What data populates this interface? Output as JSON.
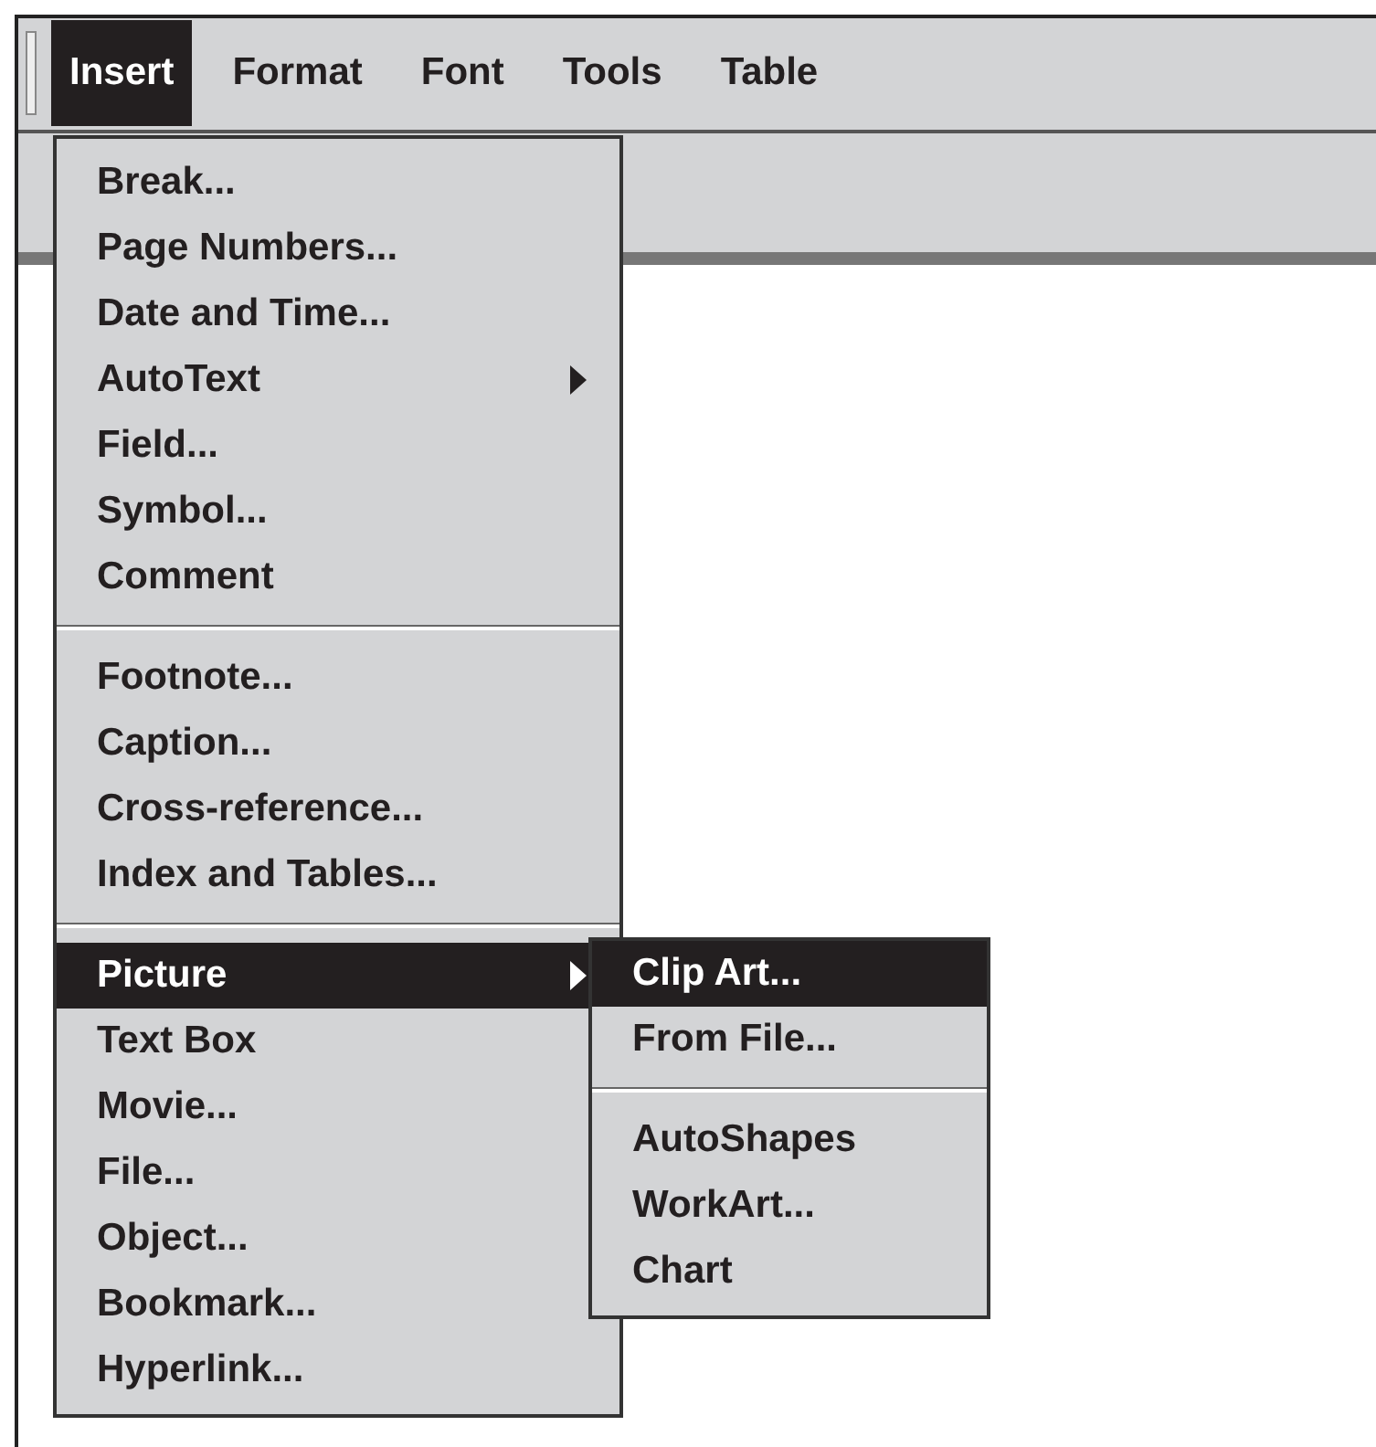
{
  "menu_bar": [
    {
      "label": "Insert",
      "selected": true
    },
    {
      "label": "Format",
      "selected": false
    },
    {
      "label": "Font",
      "selected": false
    },
    {
      "label": "Tools",
      "selected": false
    },
    {
      "label": "Table",
      "selected": false
    }
  ],
  "insert_menu": [
    {
      "kind": "item",
      "label": "Break...",
      "selected": false,
      "submenu": false
    },
    {
      "kind": "item",
      "label": "Page Numbers...",
      "selected": false,
      "submenu": false
    },
    {
      "kind": "item",
      "label": "Date and Time...",
      "selected": false,
      "submenu": false
    },
    {
      "kind": "item",
      "label": "AutoText",
      "selected": false,
      "submenu": true
    },
    {
      "kind": "item",
      "label": "Field...",
      "selected": false,
      "submenu": false
    },
    {
      "kind": "item",
      "label": "Symbol...",
      "selected": false,
      "submenu": false
    },
    {
      "kind": "item",
      "label": "Comment",
      "selected": false,
      "submenu": false
    },
    {
      "kind": "separator"
    },
    {
      "kind": "item",
      "label": "Footnote...",
      "selected": false,
      "submenu": false
    },
    {
      "kind": "item",
      "label": "Caption...",
      "selected": false,
      "submenu": false
    },
    {
      "kind": "item",
      "label": "Cross-reference...",
      "selected": false,
      "submenu": false
    },
    {
      "kind": "item",
      "label": "Index and Tables...",
      "selected": false,
      "submenu": false
    },
    {
      "kind": "separator"
    },
    {
      "kind": "item",
      "label": "Picture",
      "selected": true,
      "submenu": true
    },
    {
      "kind": "item",
      "label": "Text Box",
      "selected": false,
      "submenu": false
    },
    {
      "kind": "item",
      "label": "Movie...",
      "selected": false,
      "submenu": false
    },
    {
      "kind": "item",
      "label": "File...",
      "selected": false,
      "submenu": false
    },
    {
      "kind": "item",
      "label": "Object...",
      "selected": false,
      "submenu": false
    },
    {
      "kind": "item",
      "label": "Bookmark...",
      "selected": false,
      "submenu": false
    },
    {
      "kind": "item",
      "label": "Hyperlink...",
      "selected": false,
      "submenu": false
    }
  ],
  "picture_submenu": [
    {
      "kind": "item",
      "label": "Clip Art...",
      "selected": true
    },
    {
      "kind": "item",
      "label": "From File...",
      "selected": false
    },
    {
      "kind": "separator"
    },
    {
      "kind": "item",
      "label": "AutoShapes",
      "selected": false
    },
    {
      "kind": "item",
      "label": "WorkArt...",
      "selected": false
    },
    {
      "kind": "item",
      "label": "Chart",
      "selected": false
    }
  ]
}
